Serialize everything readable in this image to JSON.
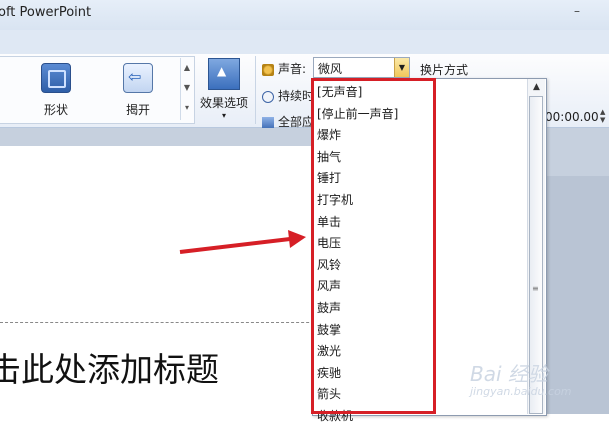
{
  "window": {
    "title": "oft PowerPoint",
    "minimize_label": "–"
  },
  "ribbon": {
    "gallery": {
      "shape_label": "形状",
      "reveal_label": "揭开"
    },
    "effect_options_label": "效果选项",
    "sound_label": "声音:",
    "sound_value": "微风",
    "duration_label": "持续时",
    "apply_all_label": "全部应",
    "switch_label": "换片方式",
    "time_value": "00:00.00"
  },
  "sound_dropdown": {
    "items": [
      "[无声音]",
      "[停止前一声音]",
      "爆炸",
      "抽气",
      "锤打",
      "打字机",
      "单击",
      "电压",
      "风铃",
      "风声",
      "鼓声",
      "鼓掌",
      "激光",
      "疾驰",
      "箭头",
      "收款机"
    ]
  },
  "slide": {
    "title_placeholder": "击此处添加标题"
  },
  "watermark": {
    "brand": "Bai 经验",
    "url": "jingyan.baidu.com"
  },
  "colors": {
    "highlight_box": "#d61f26",
    "arrow": "#d61f26"
  }
}
